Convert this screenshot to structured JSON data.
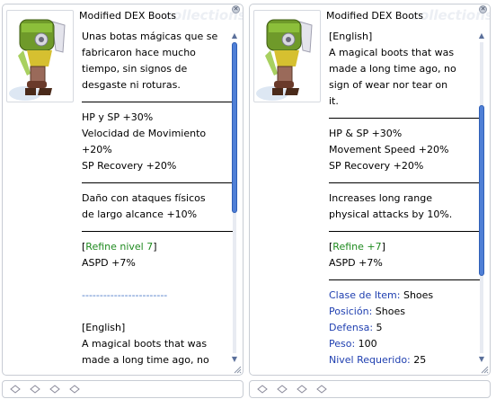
{
  "left_window": {
    "title": "Modified DEX Boots",
    "watermark": "collections",
    "lines": [
      {
        "t": "Unas botas mágicas que se"
      },
      {
        "t": "fabricaron hace mucho"
      },
      {
        "t": "tiempo, sin signos de"
      },
      {
        "t": "desgaste ni roturas."
      },
      {
        "t": "",
        "hr": true
      },
      {
        "t": "HP y SP +30%"
      },
      {
        "t": "Velocidad de Movimiento"
      },
      {
        "t": "+20%"
      },
      {
        "t": "SP Recovery +20%"
      },
      {
        "t": "",
        "hr": true
      },
      {
        "t": "Daño con ataques físicos"
      },
      {
        "t": "de largo alcance +10%"
      },
      {
        "t": "",
        "hr": true
      },
      {
        "t": "[",
        "parts": [
          {
            "t": "[",
            "c": ""
          },
          {
            "t": "Refine nivel 7",
            "c": "green"
          },
          {
            "t": "]",
            "c": ""
          }
        ]
      },
      {
        "t": "ASPD +7%"
      },
      {
        "t": ""
      },
      {
        "t": "------------------------",
        "c": "blue-dash"
      },
      {
        "t": ""
      },
      {
        "t": "[English]"
      },
      {
        "t": "A magical boots that was"
      },
      {
        "t": "made a long time ago, no"
      }
    ]
  },
  "right_window": {
    "title": "Modified DEX Boots",
    "watermark": "collections",
    "lines": [
      {
        "t": "[English]"
      },
      {
        "t": "A magical boots that was"
      },
      {
        "t": "made a long time ago, no"
      },
      {
        "t": "sign of wear nor tear on"
      },
      {
        "t": "it."
      },
      {
        "t": "",
        "hr": true
      },
      {
        "t": "HP & SP +30%"
      },
      {
        "t": "Movement Speed +20%"
      },
      {
        "t": "SP Recovery +20%"
      },
      {
        "t": "",
        "hr": true
      },
      {
        "t": "Increases long range"
      },
      {
        "t": "physical attacks by 10%."
      },
      {
        "t": "",
        "hr": true
      },
      {
        "t": "[",
        "parts": [
          {
            "t": "[",
            "c": ""
          },
          {
            "t": "Refine +7",
            "c": "green"
          },
          {
            "t": "]",
            "c": ""
          }
        ]
      },
      {
        "t": "ASPD +7%"
      },
      {
        "t": "",
        "hr": true
      },
      {
        "t": "Clase de Item:",
        "parts": [
          {
            "t": "Clase de Item:",
            "c": "blue"
          },
          {
            "t": " Shoes",
            "c": ""
          }
        ]
      },
      {
        "t": "Posición:",
        "parts": [
          {
            "t": "Posición:",
            "c": "blue"
          },
          {
            "t": " Shoes",
            "c": ""
          }
        ]
      },
      {
        "t": "Defensa:",
        "parts": [
          {
            "t": "Defensa:",
            "c": "blue"
          },
          {
            "t": " 5",
            "c": ""
          }
        ]
      },
      {
        "t": "Peso:",
        "parts": [
          {
            "t": "Peso:",
            "c": "blue"
          },
          {
            "t": " 100",
            "c": ""
          }
        ]
      },
      {
        "t": "Nivel Requerido:",
        "parts": [
          {
            "t": "Nivel Requerido:",
            "c": "blue"
          },
          {
            "t": " 25",
            "c": ""
          }
        ]
      }
    ]
  },
  "scroll": {
    "left_fraction_visible": 0.55,
    "left_position": 0.0,
    "right_fraction_visible": 0.55,
    "right_position": 0.45
  },
  "colors": {
    "thumb": "#4f7fd6",
    "green": "#1f8a1f",
    "blue": "#1f3fb0"
  },
  "icons": {
    "close": "close-icon",
    "slot": "card-slot-icon",
    "item": "boot-item-icon"
  }
}
